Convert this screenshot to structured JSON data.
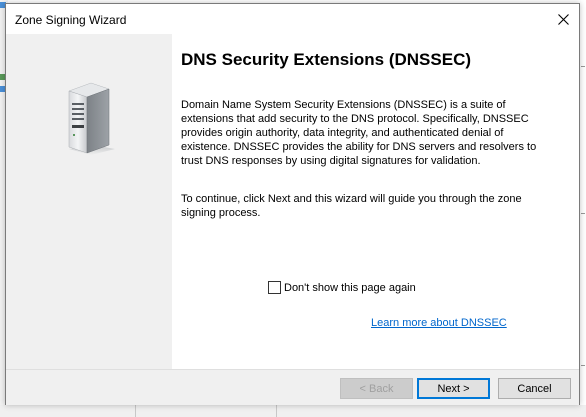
{
  "window": {
    "title": "Zone Signing Wizard"
  },
  "page": {
    "heading": "DNS Security Extensions (DNSSEC)",
    "paragraph1": "Domain Name System Security Extensions (DNSSEC) is a suite of extensions that add security to the DNS protocol. Specifically, DNSSEC provides origin authority, data integrity, and authenticated denial of existence. DNSSEC provides the ability for DNS servers and resolvers to trust DNS responses by using digital signatures for validation.",
    "paragraph2": "To continue, click Next and this wizard will guide you through the zone signing process.",
    "checkbox_label": "Don't show this page again",
    "checkbox_checked": false,
    "learn_more_link": "Learn more about DNSSEC"
  },
  "buttons": {
    "back": "< Back",
    "next": "Next >",
    "cancel": "Cancel",
    "back_enabled": false
  },
  "icons": {
    "close": "close-icon",
    "server": "server-icon"
  },
  "colors": {
    "link": "#0066cc",
    "left_panel": "#f0f0f0",
    "primary_border": "#0078d7"
  }
}
